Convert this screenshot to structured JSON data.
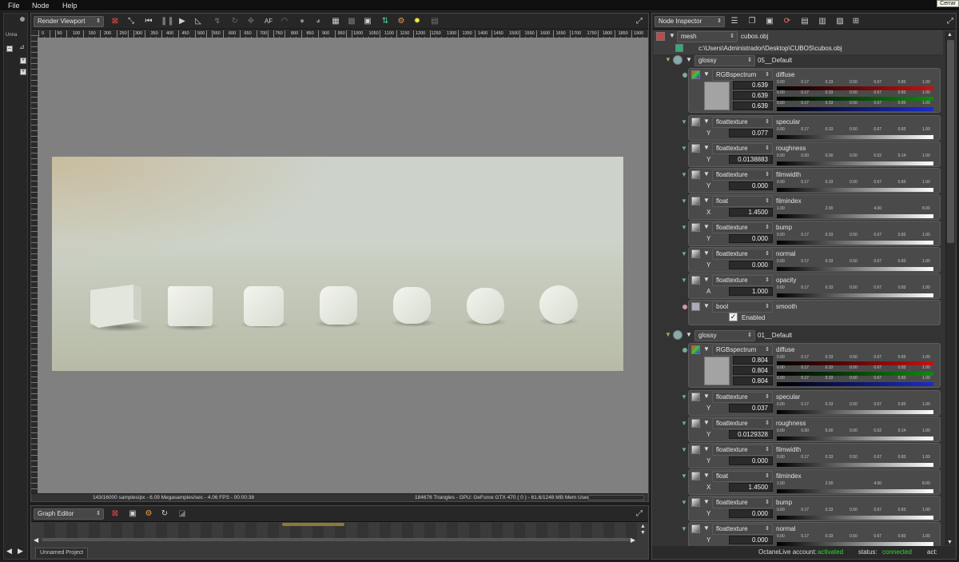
{
  "menu": {
    "file": "File",
    "node": "Node",
    "help": "Help"
  },
  "tooltip": "Cerrar",
  "leftstrip": {
    "tab": "Unna"
  },
  "viewport": {
    "combo": "Render Viewport",
    "af_label": "AF",
    "ruler_labels": [
      "0",
      "50",
      "100",
      "150",
      "200",
      "250",
      "300",
      "350",
      "400",
      "450",
      "500",
      "550",
      "600",
      "650",
      "700",
      "750",
      "800",
      "850",
      "900",
      "950",
      "1000",
      "1050",
      "1100",
      "1150",
      "1200",
      "1250",
      "1300",
      "1350",
      "1400",
      "1450",
      "1500",
      "1550",
      "1600",
      "1650",
      "1700",
      "1750",
      "1800",
      "1850",
      "1900"
    ],
    "status_left": "143/16000 samples/px - 6.09 Megasamples/sec - 4.06 FPS - 00:00:38",
    "status_right": "184676 Triangles - GPU: GeForce GTX 470 ( 0 ) - 61.6/1248 MB Mem Used"
  },
  "graph": {
    "combo": "Graph Editor",
    "tab": "Unnamed Project"
  },
  "inspector": {
    "combo": "Node Inspector",
    "mesh_type": "mesh",
    "mesh_name": "cubos.obj",
    "mesh_path": "c:\\Users\\Administrador\\Desktop\\CUBOS\\cubos.obj",
    "materials": [
      {
        "type": "glossy",
        "name": "05__Default",
        "rgb": {
          "type": "RGBspectrum",
          "name": "diffuse",
          "values": [
            "0.639",
            "0.639",
            "0.639"
          ],
          "scale": [
            "0.00",
            "0.17",
            "0.33",
            "0.50",
            "0.67",
            "0.83",
            "1.00"
          ]
        },
        "rows": [
          {
            "type": "floattexture",
            "name": "specular",
            "axis": "Y",
            "value": "0.077",
            "scale": [
              "0.00",
              "0.17",
              "0.33",
              "0.50",
              "0.67",
              "0.83",
              "1.00"
            ]
          },
          {
            "type": "floattexture",
            "name": "roughness",
            "axis": "Y",
            "value": "0.0138883",
            "scale": [
              "0.00",
              "0.00",
              "0.00",
              "0.00",
              "0.02",
              "0.14",
              "1.00"
            ]
          },
          {
            "type": "floattexture",
            "name": "filmwidth",
            "axis": "Y",
            "value": "0.000",
            "scale": [
              "0.00",
              "0.17",
              "0.33",
              "0.50",
              "0.67",
              "0.83",
              "1.00"
            ]
          },
          {
            "type": "float",
            "name": "filmindex",
            "axis": "X",
            "value": "1.4500",
            "scale": [
              "1.00",
              "2.00",
              "4.00",
              "8.00"
            ]
          },
          {
            "type": "floattexture",
            "name": "bump",
            "axis": "Y",
            "value": "0.000",
            "scale": [
              "0.00",
              "0.17",
              "0.33",
              "0.50",
              "0.67",
              "0.83",
              "1.00"
            ]
          },
          {
            "type": "floattexture",
            "name": "normal",
            "axis": "Y",
            "value": "0.000",
            "scale": [
              "0.00",
              "0.17",
              "0.33",
              "0.50",
              "0.67",
              "0.83",
              "1.00"
            ]
          },
          {
            "type": "floattexture",
            "name": "opacity",
            "axis": "A",
            "value": "1.000",
            "scale": [
              "0.00",
              "0.17",
              "0.33",
              "0.50",
              "0.67",
              "0.83",
              "1.00"
            ]
          }
        ],
        "bool": {
          "type": "bool",
          "name": "smooth",
          "label": "Enabled"
        }
      },
      {
        "type": "glossy",
        "name": "01__Default",
        "rgb": {
          "type": "RGBspectrum",
          "name": "diffuse",
          "values": [
            "0.804",
            "0.804",
            "0.804"
          ],
          "scale": [
            "0.00",
            "0.17",
            "0.33",
            "0.50",
            "0.67",
            "0.83",
            "1.00"
          ]
        },
        "rows": [
          {
            "type": "floattexture",
            "name": "specular",
            "axis": "Y",
            "value": "0.037",
            "scale": [
              "0.00",
              "0.17",
              "0.33",
              "0.50",
              "0.67",
              "0.83",
              "1.00"
            ]
          },
          {
            "type": "floattexture",
            "name": "roughness",
            "axis": "Y",
            "value": "0.0129328",
            "scale": [
              "0.00",
              "0.00",
              "0.00",
              "0.00",
              "0.02",
              "0.14",
              "1.00"
            ]
          },
          {
            "type": "floattexture",
            "name": "filmwidth",
            "axis": "Y",
            "value": "0.000",
            "scale": [
              "0.00",
              "0.17",
              "0.33",
              "0.50",
              "0.67",
              "0.83",
              "1.00"
            ]
          },
          {
            "type": "float",
            "name": "filmindex",
            "axis": "X",
            "value": "1.4500",
            "scale": [
              "1.00",
              "2.00",
              "4.00",
              "8.00"
            ]
          },
          {
            "type": "floattexture",
            "name": "bump",
            "axis": "Y",
            "value": "0.000",
            "scale": [
              "0.00",
              "0.17",
              "0.33",
              "0.50",
              "0.67",
              "0.83",
              "1.00"
            ]
          },
          {
            "type": "floattexture",
            "name": "normal",
            "axis": "Y",
            "value": "0.000",
            "scale": [
              "0.00",
              "0.17",
              "0.33",
              "0.50",
              "0.67",
              "0.83",
              "1.00"
            ]
          }
        ]
      }
    ]
  },
  "footer": {
    "account_label": "OctaneLive account:",
    "account_value": "activated",
    "status_label": "status:",
    "status_value": "connected",
    "act_label": "act:"
  },
  "colors": {
    "green": "#2fdc2f",
    "red": "#c81010",
    "chan_green": "#0e8a0e",
    "blue": "#1a2ccc"
  }
}
